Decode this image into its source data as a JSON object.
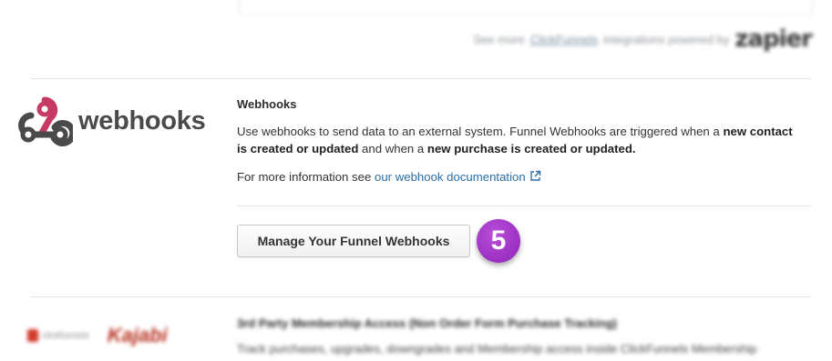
{
  "zapier": {
    "prefix": "See more",
    "link": "ClickFunnels",
    "suffix": "integrations powered by",
    "logo_text": "zapier"
  },
  "webhooks": {
    "logo_text": "webhooks",
    "title": "Webhooks",
    "desc_1": "Use webhooks to send data to an external system. Funnel Webhooks are triggered when a ",
    "desc_bold_1": "new contact is created or updated",
    "desc_2": " and when a ",
    "desc_bold_2": "new purchase is created or updated.",
    "more_prefix": "For more information see ",
    "doc_link": "our webhook documentation",
    "manage_button": "Manage Your Funnel Webhooks",
    "step_number": "5",
    "logo_colors": [
      "#c73a63",
      "#4a4a4a"
    ]
  },
  "membership": {
    "title": "3rd Party Membership Access (Non Order Form Purchase Tracking)",
    "desc": "Track purchases, upgrades, downgrades and Membership access inside ClickFunnels Membership",
    "logo_1": "clickfunnels",
    "logo_2": "Kajabi"
  }
}
